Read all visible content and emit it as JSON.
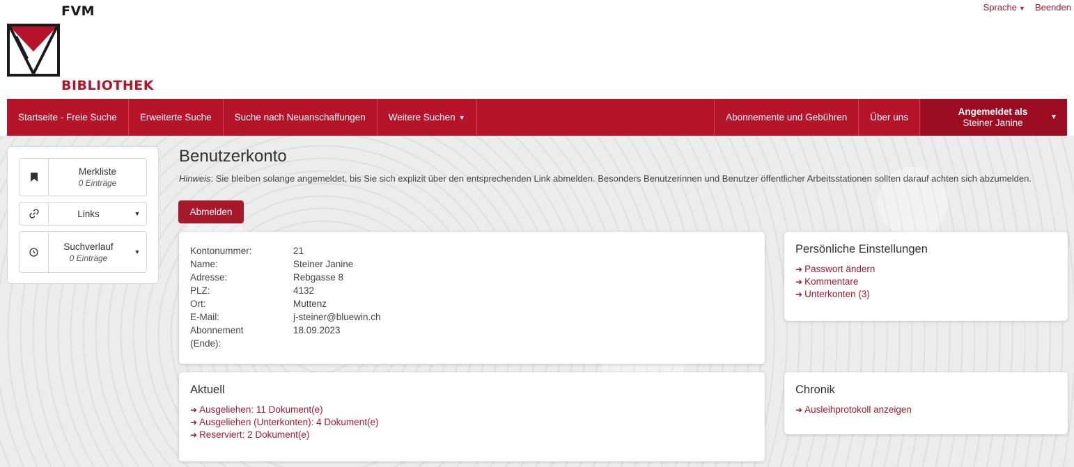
{
  "topbar": {
    "language_label": "Sprache",
    "quit_label": "Beenden"
  },
  "logo": {
    "top_text": "FVM",
    "bottom_text": "BIBLIOTHEK"
  },
  "nav": {
    "items": [
      {
        "label": "Startseite - Freie Suche"
      },
      {
        "label": "Erweiterte Suche"
      },
      {
        "label": "Suche nach Neuanschaffungen"
      },
      {
        "label": "Weitere Suchen"
      }
    ],
    "right_items": [
      {
        "label": "Abonnemente und Gebühren"
      },
      {
        "label": "Über uns"
      }
    ],
    "user": {
      "title": "Angemeldet als",
      "name": "Steiner Janine"
    }
  },
  "sidebar": {
    "merkliste": {
      "title": "Merkliste",
      "sub": "0 Einträge"
    },
    "links": {
      "title": "Links"
    },
    "suchverlauf": {
      "title": "Suchverlauf",
      "sub": "0 Einträge"
    }
  },
  "main": {
    "title": "Benutzerkonto",
    "hint_label": "Hinweis",
    "hint_text": ": Sie bleiben solange angemeldet, bis Sie sich explizit über den entsprechenden Link abmelden. Besonders Benutzerinnen und Benutzer öffentlicher Arbeitsstationen sollten darauf achten sich abzumelden.",
    "logout_label": "Abmelden"
  },
  "account": {
    "rows": [
      {
        "label": "Kontonummer:",
        "value": "21"
      },
      {
        "label": "Name:",
        "value": "Steiner Janine"
      },
      {
        "label": "Adresse:",
        "value": "Rebgasse 8"
      },
      {
        "label": "PLZ:",
        "value": "4132"
      },
      {
        "label": "Ort:",
        "value": "Muttenz"
      },
      {
        "label": "E-Mail:",
        "value": "j-steiner@bluewin.ch"
      },
      {
        "label": "Abonnement (Ende):",
        "value": "18.09.2023"
      }
    ]
  },
  "settings": {
    "title": "Persönliche Einstellungen",
    "links": [
      "Passwort ändern",
      "Kommentare",
      "Unterkonten (3)"
    ]
  },
  "aktuell": {
    "title": "Aktuell",
    "links": [
      "Ausgeliehen: 11 Dokument(e)",
      "Ausgeliehen (Unterkonten): 4 Dokument(e)",
      "Reserviert: 2 Dokument(e)"
    ]
  },
  "chronik": {
    "title": "Chronik",
    "links": [
      "Ausleihprotokoll anzeigen"
    ]
  },
  "colors": {
    "brand_red": "#b5142a",
    "link_red": "#a8182b",
    "user_dark_red": "#9c0d22"
  }
}
